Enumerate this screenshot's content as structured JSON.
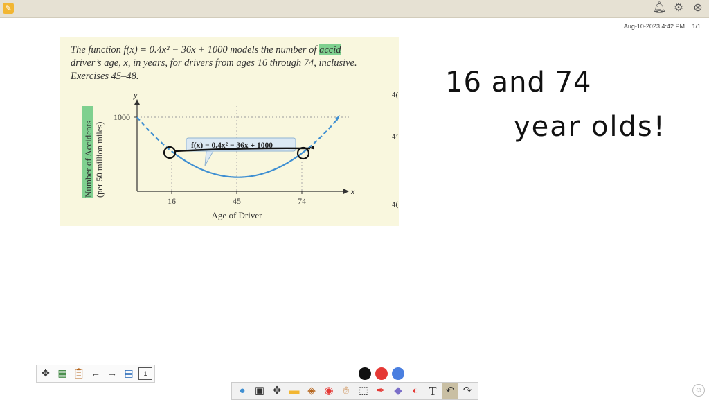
{
  "meta": {
    "date": "Aug-10-2023 4:42 PM",
    "page": "1/1"
  },
  "problem": {
    "line1_pre": "The function f(x) = 0.4x² − 36x + 1000 models the number of ",
    "line1_hl": "accid",
    "line2": "driver’s age, x, in years, for drivers from ages 16 through 74, inclusive.",
    "line3": "Exercises 45–48."
  },
  "margin_numbers": [
    "4(",
    "4’",
    "4("
  ],
  "graph": {
    "y_axis_var": "y",
    "x_axis_var": "x",
    "ylabel_1": "Number of Accidents",
    "ylabel_2": "(per 50 million miles)",
    "xlabel": "Age of Driver",
    "y_tick": "1000",
    "x_ticks": [
      "16",
      "45",
      "74"
    ],
    "annotation": "f(x) = 0.4x² − 36x + 1000"
  },
  "handwriting": {
    "line1": "16 and 74",
    "line2": "year olds!"
  },
  "colors": {
    "accent": "#f2b632",
    "swatches": [
      "#111111",
      "#e53935",
      "#4a7fe0"
    ]
  },
  "icons": {
    "top": [
      "bell-icon",
      "settings-icon",
      "close-icon"
    ],
    "left_toolbar": [
      "move-icon",
      "image-icon",
      "clipboard-icon",
      "arrow-left-icon",
      "arrow-right-icon",
      "page-add-icon",
      "page-icon"
    ],
    "bottom_toolbar": [
      "people-icon",
      "camera-icon",
      "move-icon",
      "folder-icon",
      "box-icon",
      "chrome-icon",
      "hand-icon",
      "select-icon",
      "pen-icon",
      "eraser-icon",
      "shapes-icon",
      "text-icon",
      "undo-icon",
      "redo-icon"
    ]
  },
  "page_indicator": "1",
  "chart_data": {
    "type": "line",
    "xlabel": "Age of Driver",
    "ylabel": "Number of Accidents (per 50 million miles)",
    "x_ticks": [
      16,
      45,
      74
    ],
    "y_ticks": [
      1000
    ],
    "series": [
      {
        "name": "f(x) = 0.4x² − 36x + 1000",
        "x": [
          5,
          10,
          16,
          20,
          25,
          30,
          35,
          40,
          45,
          50,
          55,
          60,
          65,
          70,
          74,
          80,
          85
        ],
        "y": [
          830,
          680,
          526,
          440,
          350,
          280,
          230,
          200,
          190,
          200,
          230,
          280,
          350,
          440,
          526,
          680,
          830
        ]
      }
    ]
  }
}
